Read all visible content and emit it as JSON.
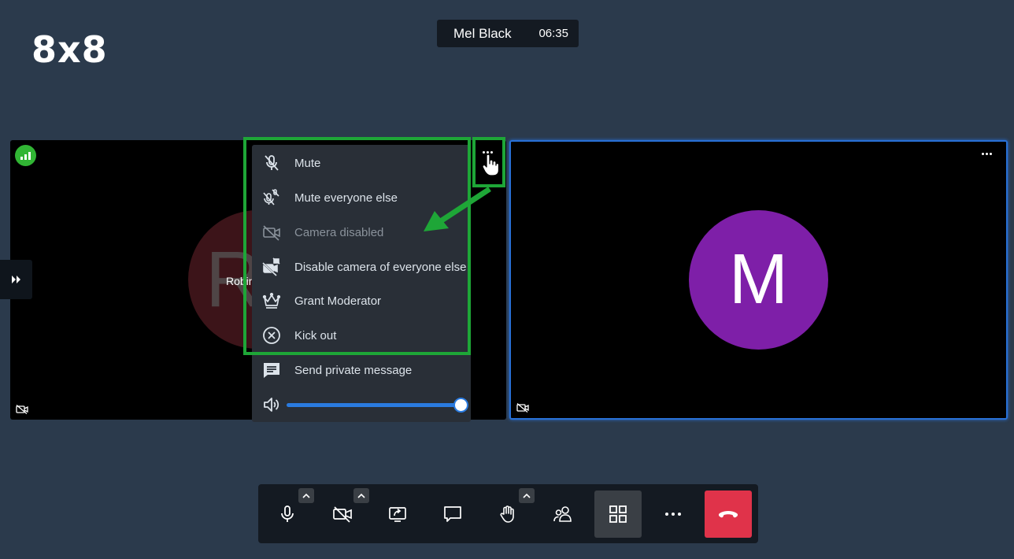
{
  "app": {
    "logo_text": "8x8"
  },
  "header": {
    "participant_name": "Mel Black",
    "timer": "06:35"
  },
  "tiles": {
    "left": {
      "name": "Robin",
      "avatar_letter": "R",
      "avatar_color": "#3c1419"
    },
    "right": {
      "avatar_letter": "M",
      "avatar_color": "#7e1fa8",
      "active_speaker_border": "#2870d6"
    }
  },
  "context_menu": {
    "items": [
      {
        "label": "Mute",
        "icon": "mic-off-icon",
        "disabled": false
      },
      {
        "label": "Mute everyone else",
        "icon": "mute-everyone-icon",
        "disabled": false
      },
      {
        "label": "Camera disabled",
        "icon": "camera-off-icon",
        "disabled": true
      },
      {
        "label": "Disable camera of everyone else",
        "icon": "camera-off-everyone-icon",
        "disabled": false
      },
      {
        "label": "Grant Moderator",
        "icon": "crown-icon",
        "disabled": false
      },
      {
        "label": "Kick out",
        "icon": "close-circle-icon",
        "disabled": false
      },
      {
        "label": "Send private message",
        "icon": "message-icon",
        "disabled": false
      }
    ],
    "volume_level": 1.0
  },
  "annotations": {
    "highlight_color": "#1ea637"
  },
  "toolbar": {
    "buttons": [
      {
        "name": "microphone",
        "icon": "microphone-icon",
        "has_caret": true
      },
      {
        "name": "camera",
        "icon": "camera-off-icon",
        "has_caret": true
      },
      {
        "name": "screen-share",
        "icon": "screen-share-icon",
        "has_caret": false
      },
      {
        "name": "chat",
        "icon": "chat-icon",
        "has_caret": false
      },
      {
        "name": "raise-hand",
        "icon": "hand-icon",
        "has_caret": true
      },
      {
        "name": "participants",
        "icon": "participants-icon",
        "has_caret": false
      },
      {
        "name": "tile-view",
        "icon": "grid-icon",
        "has_caret": false,
        "active": true
      },
      {
        "name": "more",
        "icon": "more-dots-icon",
        "has_caret": false
      },
      {
        "name": "hangup",
        "icon": "phone-hangup-icon",
        "has_caret": false
      }
    ],
    "hangup_color": "#e0334a"
  }
}
